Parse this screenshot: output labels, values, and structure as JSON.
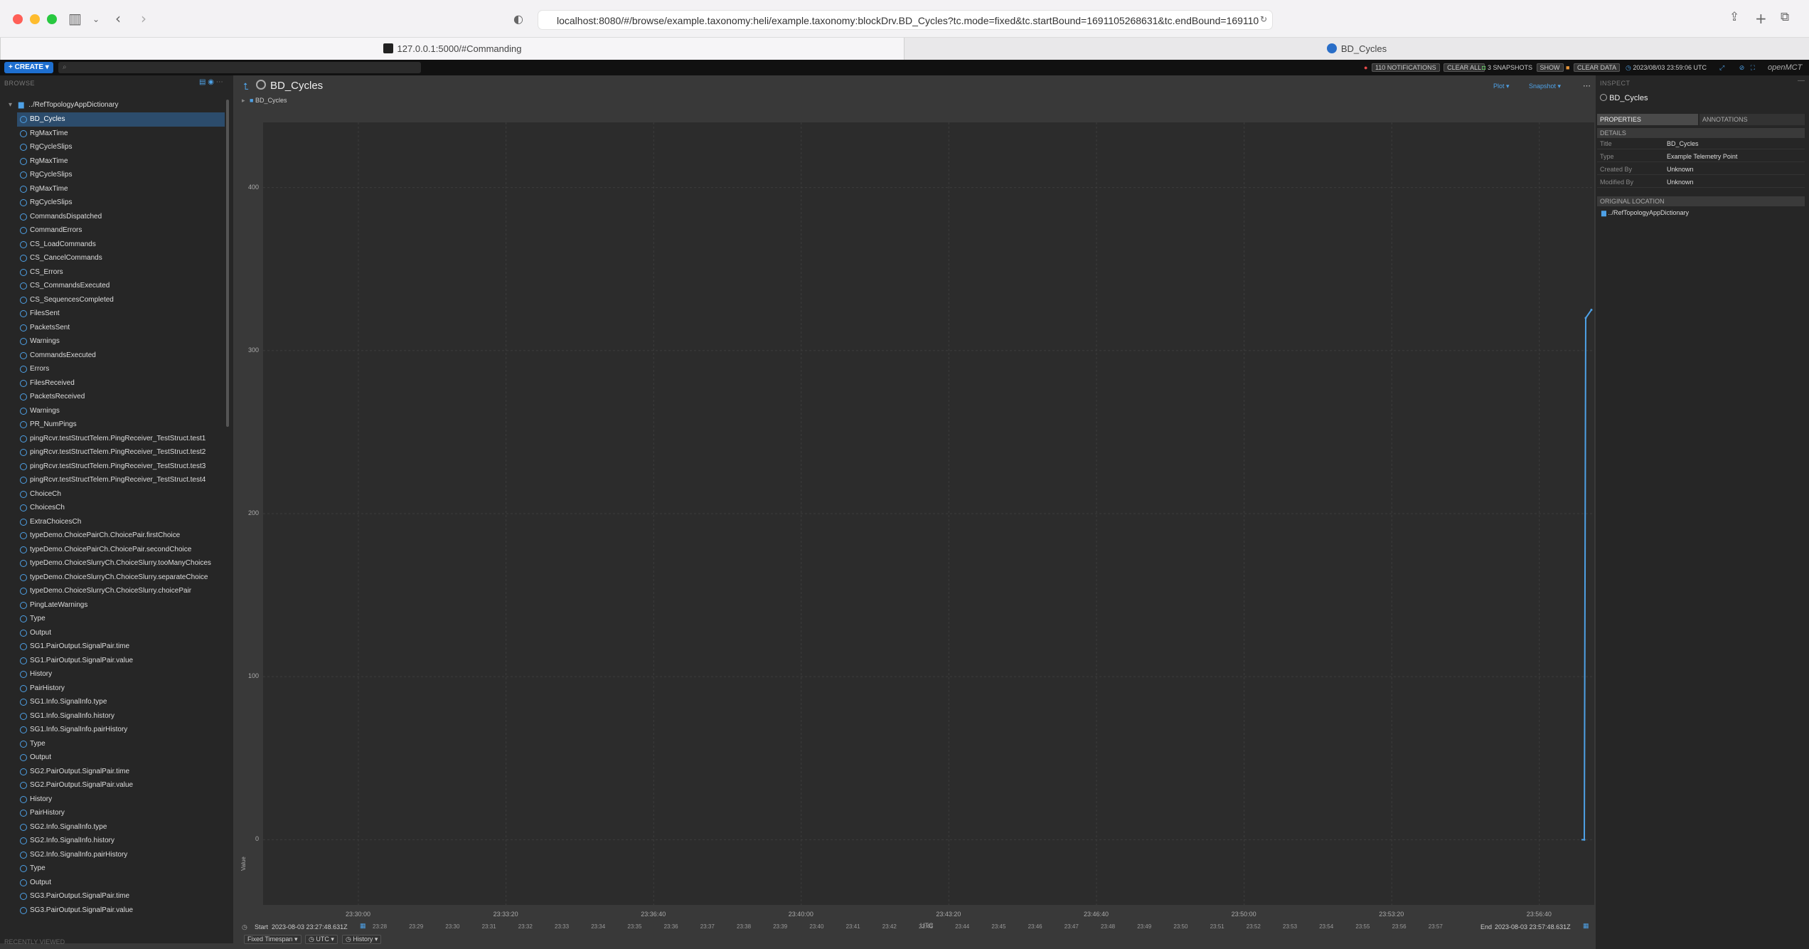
{
  "browser": {
    "url": "localhost:8080/#/browse/example.taxonomy:heli/example.taxonomy:blockDrv.BD_Cycles?tc.mode=fixed&tc.startBound=1691105268631&tc.endBound=169110",
    "tabs": [
      {
        "label": "127.0.0.1:5000/#Commanding",
        "active": true
      },
      {
        "label": "BD_Cycles",
        "active": false
      }
    ]
  },
  "topbar": {
    "create_label": "CREATE",
    "notifications": "110 NOTIFICATIONS",
    "clear_all": "CLEAR ALL",
    "snapshots": "3 SNAPSHOTS",
    "show": "SHOW",
    "clear_data": "CLEAR DATA",
    "clock": "2023/08/03 23:59:06 UTC",
    "brand": "openMCT"
  },
  "sidebar": {
    "title": "BROWSE",
    "root": "../RefTopologyAppDictionary",
    "recently_viewed": "RECENTLY VIEWED",
    "items": [
      "BD_Cycles",
      "RgMaxTime",
      "RgCycleSlips",
      "RgMaxTime",
      "RgCycleSlips",
      "RgMaxTime",
      "RgCycleSlips",
      "CommandsDispatched",
      "CommandErrors",
      "CS_LoadCommands",
      "CS_CancelCommands",
      "CS_Errors",
      "CS_CommandsExecuted",
      "CS_SequencesCompleted",
      "FilesSent",
      "PacketsSent",
      "Warnings",
      "CommandsExecuted",
      "Errors",
      "FilesReceived",
      "PacketsReceived",
      "Warnings",
      "PR_NumPings",
      "pingRcvr.testStructTelem.PingReceiver_TestStruct.test1",
      "pingRcvr.testStructTelem.PingReceiver_TestStruct.test2",
      "pingRcvr.testStructTelem.PingReceiver_TestStruct.test3",
      "pingRcvr.testStructTelem.PingReceiver_TestStruct.test4",
      "ChoiceCh",
      "ChoicesCh",
      "ExtraChoicesCh",
      "typeDemo.ChoicePairCh.ChoicePair.firstChoice",
      "typeDemo.ChoicePairCh.ChoicePair.secondChoice",
      "typeDemo.ChoiceSlurryCh.ChoiceSlurry.tooManyChoices",
      "typeDemo.ChoiceSlurryCh.ChoiceSlurry.separateChoice",
      "typeDemo.ChoiceSlurryCh.ChoiceSlurry.choicePair",
      "PingLateWarnings",
      "Type",
      "Output",
      "SG1.PairOutput.SignalPair.time",
      "SG1.PairOutput.SignalPair.value",
      "History",
      "PairHistory",
      "SG1.Info.SignalInfo.type",
      "SG1.Info.SignalInfo.history",
      "SG1.Info.SignalInfo.pairHistory",
      "Type",
      "Output",
      "SG2.PairOutput.SignalPair.time",
      "SG2.PairOutput.SignalPair.value",
      "History",
      "PairHistory",
      "SG2.Info.SignalInfo.type",
      "SG2.Info.SignalInfo.history",
      "SG2.Info.SignalInfo.pairHistory",
      "Type",
      "Output",
      "SG3.PairOutput.SignalPair.time",
      "SG3.PairOutput.SignalPair.value"
    ]
  },
  "main": {
    "title": "BD_Cycles",
    "legend": "BD_Cycles",
    "view_label": "Plot",
    "snapshot_label": "Snapshot",
    "xaxis_title": "UTC",
    "yaxis_title": "Value"
  },
  "chart_data": {
    "type": "line",
    "title": "",
    "xlabel": "UTC",
    "ylabel": "Value",
    "ylim": [
      -40,
      440
    ],
    "yticks": [
      0,
      100,
      200,
      300,
      400
    ],
    "xticks": [
      "23:30:00",
      "23:33:20",
      "23:36:40",
      "23:40:00",
      "23:43:20",
      "23:46:40",
      "23:50:00",
      "23:53:20",
      "23:56:40"
    ],
    "series": [
      {
        "name": "BD_Cycles",
        "color": "#4ea1e6",
        "x": [
          "23:56:45",
          "23:56:46",
          "23:56:47"
        ],
        "y": [
          0,
          320,
          325
        ]
      }
    ],
    "grid": true
  },
  "timeconductor": {
    "start_label": "Start",
    "start": "2023-08-03 23:27:48.631Z",
    "end_label": "End",
    "end": "2023-08-03 23:57:48.631Z",
    "mode": "Fixed Timespan",
    "timesystem": "UTC",
    "history": "History",
    "ticks": [
      "23:28",
      "23:29",
      "23:30",
      "23:31",
      "23:32",
      "23:33",
      "23:34",
      "23:35",
      "23:36",
      "23:37",
      "23:38",
      "23:39",
      "23:40",
      "23:41",
      "23:42",
      "23:43",
      "23:44",
      "23:45",
      "23:46",
      "23:47",
      "23:48",
      "23:49",
      "23:50",
      "23:51",
      "23:52",
      "23:53",
      "23:54",
      "23:55",
      "23:56",
      "23:57"
    ]
  },
  "inspector": {
    "title": "INSPECT",
    "object": "BD_Cycles",
    "tab_properties": "PROPERTIES",
    "tab_annotations": "ANNOTATIONS",
    "details_header": "DETAILS",
    "rows": [
      {
        "label": "Title",
        "value": "BD_Cycles"
      },
      {
        "label": "Type",
        "value": "Example Telemetry Point"
      },
      {
        "label": "Created By",
        "value": "Unknown"
      },
      {
        "label": "Modified By",
        "value": "Unknown"
      }
    ],
    "location_header": "ORIGINAL LOCATION",
    "location": "../RefTopologyAppDictionary"
  }
}
